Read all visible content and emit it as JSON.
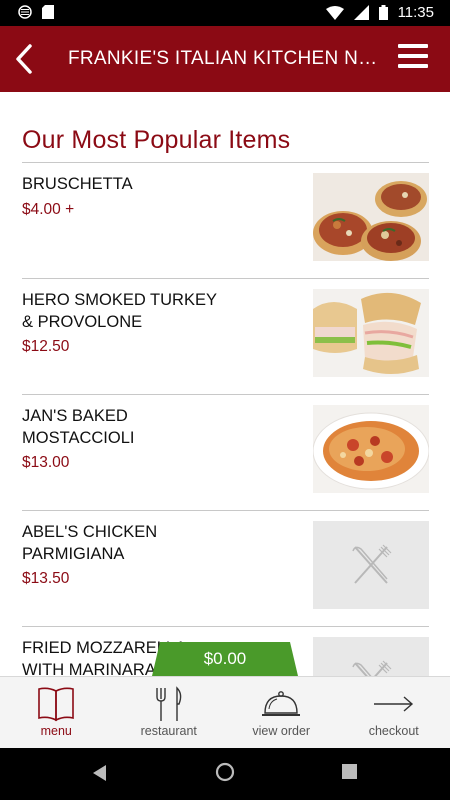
{
  "status_bar": {
    "time": "11:35",
    "icons_left": [
      "circle-status-icon",
      "sd-card-icon"
    ],
    "icons_right": [
      "wifi-icon",
      "signal-icon",
      "battery-icon"
    ]
  },
  "app_bar": {
    "title": "FRANKIE'S ITALIAN KITCHEN NORTHBROOK",
    "background": "#8b0a14"
  },
  "section": {
    "title": "Our Most Popular Items"
  },
  "items": [
    {
      "name_lines": [
        "BRUSCHETTA"
      ],
      "price": "$4.00 +",
      "image": "bruschetta-photo"
    },
    {
      "name_lines": [
        "HERO SMOKED TURKEY",
        "& PROVOLONE"
      ],
      "price": "$12.50",
      "image": "sandwich-photo"
    },
    {
      "name_lines": [
        "JAN'S BAKED",
        "MOSTACCIOLI"
      ],
      "price": "$13.00",
      "image": "pasta-photo"
    },
    {
      "name_lines": [
        "ABEL'S CHICKEN",
        "PARMIGIANA"
      ],
      "price": "$13.50",
      "image": "placeholder-utensils-icon"
    },
    {
      "name_lines": [
        "FRIED MOZZARELLA",
        "WITH MARINARA"
      ],
      "price": "",
      "image": "placeholder-utensils-icon"
    }
  ],
  "cart": {
    "total": "$0.00",
    "color": "#4a9a2a"
  },
  "bottom_nav": [
    {
      "label": "menu",
      "icon": "book-icon",
      "active": true
    },
    {
      "label": "restaurant",
      "icon": "fork-knife-icon",
      "active": false
    },
    {
      "label": "view order",
      "icon": "cloche-icon",
      "active": false
    },
    {
      "label": "checkout",
      "icon": "arrow-right-icon",
      "active": false
    }
  ]
}
